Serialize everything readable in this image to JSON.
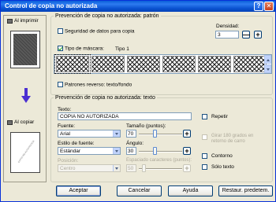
{
  "window": {
    "title": "Control de copia no autorizada",
    "help_glyph": "?",
    "close_glyph": "✕"
  },
  "sidebar": {
    "print_label": "Al imprimir",
    "copy_label": "Al copiar",
    "watermark_sample": "COPIA NO AUTORIZADA"
  },
  "pattern_group": {
    "legend": "Prevención de copia no autorizada: patrón",
    "security_checkbox": {
      "label": "Seguridad de datos para copia",
      "checked": false
    },
    "density": {
      "label": "Densidad:",
      "value": "3",
      "minus": "—",
      "plus": "+"
    },
    "mask_checkbox": {
      "label": "Tipo de máscara:",
      "checked": true
    },
    "mask_value": "Tipo 1",
    "reverse_checkbox": {
      "label": "Patrones reverso: texto/fondo",
      "checked": false
    }
  },
  "text_group": {
    "legend": "Prevención de copia no autorizada: texto",
    "text_label": "Texto:",
    "text_value": "COPIA NO AUTORIZADA",
    "font_label": "Fuente:",
    "font_value": "Arial",
    "size_label": "Tamaño (puntos):",
    "size_value": "70",
    "style_label": "Estilo de fuente:",
    "style_value": "Estándar",
    "angle_label": "Ángulo:",
    "angle_value": "30",
    "position_label": "Posición:",
    "position_value": "Centro",
    "spacing_label": "Espaciado caracteres (puntos):",
    "spacing_value": "50",
    "minus": "—",
    "plus": "+",
    "repeat": {
      "label": "Repetir",
      "checked": false
    },
    "rotate180": {
      "label": "Girar 180 grados en retorno de carro",
      "checked": false
    },
    "outline": {
      "label": "Contorno",
      "checked": false
    },
    "text_only": {
      "label": "Sólo texto",
      "checked": false
    }
  },
  "buttons": {
    "ok": "Aceptar",
    "cancel": "Cancelar",
    "help": "Ayuda",
    "restore": "Restaur. predetem."
  }
}
